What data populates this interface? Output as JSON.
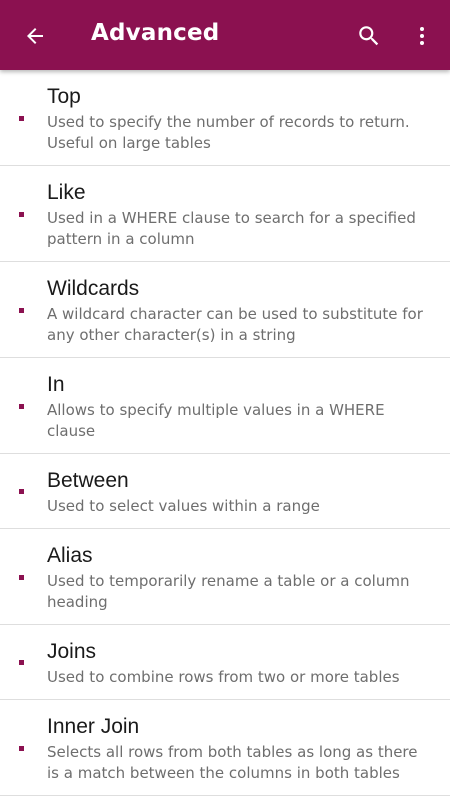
{
  "colors": {
    "app_bar": "#8b1150",
    "bullet": "#8b1150"
  },
  "app_bar": {
    "title": "Advanced",
    "back_icon": "arrow-left-icon",
    "search_icon": "search-icon",
    "more_icon": "more-vertical-icon"
  },
  "items": [
    {
      "title": "Top",
      "desc": "Used to specify the number of records to return. Useful on large tables"
    },
    {
      "title": "Like",
      "desc": "Used in a WHERE clause to search for a specified pattern in a column"
    },
    {
      "title": "Wildcards",
      "desc": "A wildcard character can be used to substitute for any other character(s) in a string"
    },
    {
      "title": "In",
      "desc": "Allows to specify multiple values in a WHERE clause"
    },
    {
      "title": "Between",
      "desc": "Used to select values within a range"
    },
    {
      "title": "Alias",
      "desc": "Used to temporarily rename a table or a column heading"
    },
    {
      "title": "Joins",
      "desc": "Used to combine rows from two or more tables"
    },
    {
      "title": "Inner Join",
      "desc": "Selects all rows from both tables as long as there is a match between the columns in both tables"
    }
  ]
}
